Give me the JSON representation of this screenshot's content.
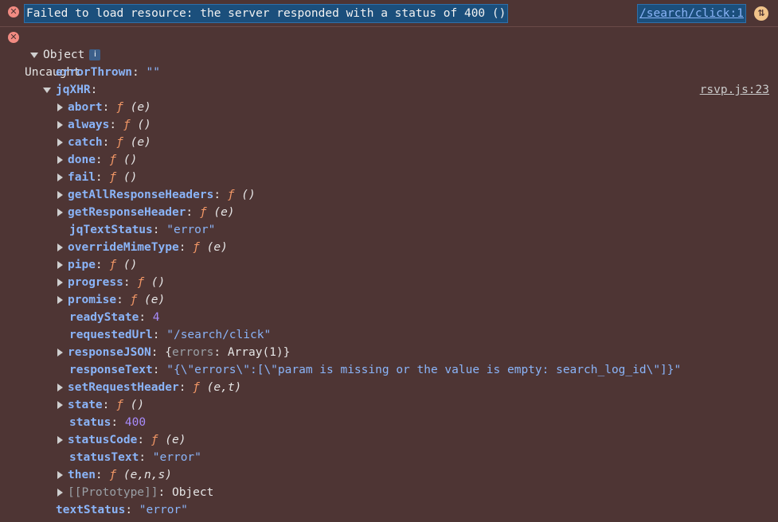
{
  "error_bar": {
    "message": "Failed to load resource: the server responded with a status of 400 ()",
    "source": "/search/click:1"
  },
  "uncaught": {
    "label": "Uncaught",
    "source": "rsvp.js:23"
  },
  "object": {
    "label": "Object",
    "info": "i"
  },
  "error_thrown": {
    "key": "errorThrown",
    "value": "\"\""
  },
  "jqxhr": {
    "key": "jqXHR",
    "props": [
      {
        "key": "abort",
        "kind": "fn",
        "args": "(e)"
      },
      {
        "key": "always",
        "kind": "fn",
        "args": "()"
      },
      {
        "key": "catch",
        "kind": "fn",
        "args": "(e)"
      },
      {
        "key": "done",
        "kind": "fn",
        "args": "()"
      },
      {
        "key": "fail",
        "kind": "fn",
        "args": "()"
      },
      {
        "key": "getAllResponseHeaders",
        "kind": "fn",
        "args": "()"
      },
      {
        "key": "getResponseHeader",
        "kind": "fn",
        "args": "(e)"
      },
      {
        "key": "jqTextStatus",
        "kind": "str",
        "value": "\"error\""
      },
      {
        "key": "overrideMimeType",
        "kind": "fn",
        "args": "(e)"
      },
      {
        "key": "pipe",
        "kind": "fn",
        "args": "()"
      },
      {
        "key": "progress",
        "kind": "fn",
        "args": "()"
      },
      {
        "key": "promise",
        "kind": "fn",
        "args": "(e)"
      },
      {
        "key": "readyState",
        "kind": "num",
        "value": "4"
      },
      {
        "key": "requestedUrl",
        "kind": "str",
        "value": "\"/search/click\""
      },
      {
        "key": "responseJSON",
        "kind": "obj",
        "value_key": "errors",
        "value_val": "Array(1)"
      },
      {
        "key": "responseText",
        "kind": "str",
        "value": "\"{\\\"errors\\\":[\\\"param is missing or the value is empty: search_log_id\\\"]}\""
      },
      {
        "key": "setRequestHeader",
        "kind": "fn",
        "args": "(e,t)"
      },
      {
        "key": "state",
        "kind": "fn",
        "args": "()"
      },
      {
        "key": "status",
        "kind": "num",
        "value": "400"
      },
      {
        "key": "statusCode",
        "kind": "fn",
        "args": "(e)"
      },
      {
        "key": "statusText",
        "kind": "str",
        "value": "\"error\""
      },
      {
        "key": "then",
        "kind": "fn",
        "args": "(e,n,s)"
      },
      {
        "key": "[[Prototype]]",
        "kind": "proto",
        "value": "Object"
      }
    ]
  },
  "text_status": {
    "key": "textStatus",
    "value": "\"error\""
  },
  "glyphs": {
    "f": "ƒ",
    "error_x": "✕",
    "corner": "⇅"
  },
  "colors": {
    "background": "#4e3534",
    "key": "#8ab4f8",
    "function": "#f29766",
    "number": "#a78bfa",
    "error": "#f28b82"
  }
}
